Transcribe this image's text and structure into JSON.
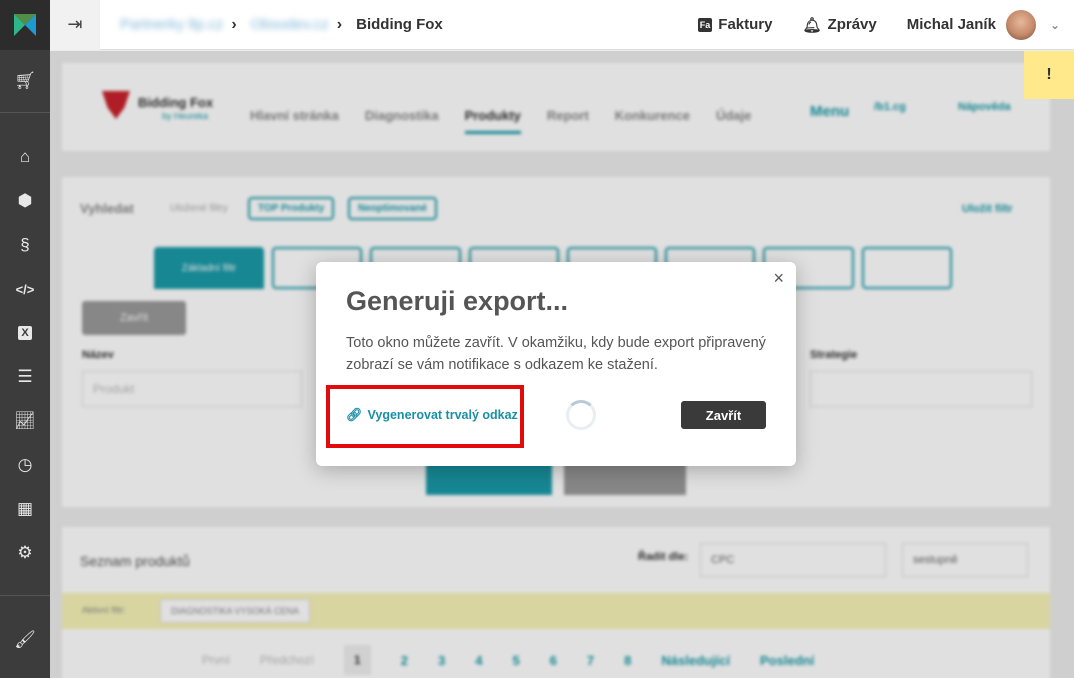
{
  "sidebar": {
    "icons": [
      "logo-icon",
      "cart-icon",
      "home-icon",
      "box-icon",
      "paragraph-icon",
      "code-icon",
      "excel-icon",
      "playlist-icon",
      "chart-icon",
      "clock-icon",
      "grid-icon",
      "gear-icon",
      "brush-icon"
    ]
  },
  "topbar": {
    "breadcrumb_1": "Partnerky ltp.cz",
    "breadcrumb_2": "Obsodev.cz",
    "breadcrumb_current": "Bidding Fox",
    "invoices": "Faktury",
    "messages": "Zprávy",
    "user_name": "Michal Janík",
    "fa_badge": "Fa"
  },
  "background": {
    "app_logo": "Bidding Fox",
    "app_logo_sub": "by Heureka",
    "nav": [
      "Hlavní stránka",
      "Diagnostika",
      "Produkty",
      "Report",
      "Konkurence",
      "Údaje"
    ],
    "menu": "Menu",
    "shortlink": "/b1.cg",
    "help": "Nápověda",
    "alert": "!",
    "search_label": "Vyhledat",
    "saved_filters": "Uložené filtry",
    "filter_tag_1": "TOP Produkty",
    "filter_tag_2": "Neoptimované",
    "save_filter": "Uložit filtr",
    "tab_basic": "Základní filtr",
    "name_label": "Název",
    "name_placeholder": "Produkt",
    "strategy_label": "Strategie",
    "close_filter": "Zavřít",
    "product_list": "Seznam produktů",
    "sort_by": "Řadit dle:",
    "sort_value": "CPC",
    "sort_dir": "sestupně",
    "active_filter_label": "Aktivní filtr:",
    "active_filter_value": "DIAGNOSTIKA VYSOKÁ CENA",
    "pager_prev": "První",
    "pager_prev2": "Předchozí",
    "pages": [
      "1",
      "2",
      "3",
      "4",
      "5",
      "6",
      "7",
      "8"
    ],
    "pager_next": "Následující",
    "pager_last": "Poslední"
  },
  "modal": {
    "title": "Generuji export...",
    "text": "Toto okno můžete zavřít. V okamžiku, kdy bude export připravený zobrazí se vám notifikace s odkazem ke stažení.",
    "permalink": "Vygenerovat trvalý odkaz",
    "close_button": "Zavřít",
    "close_icon": "×"
  }
}
